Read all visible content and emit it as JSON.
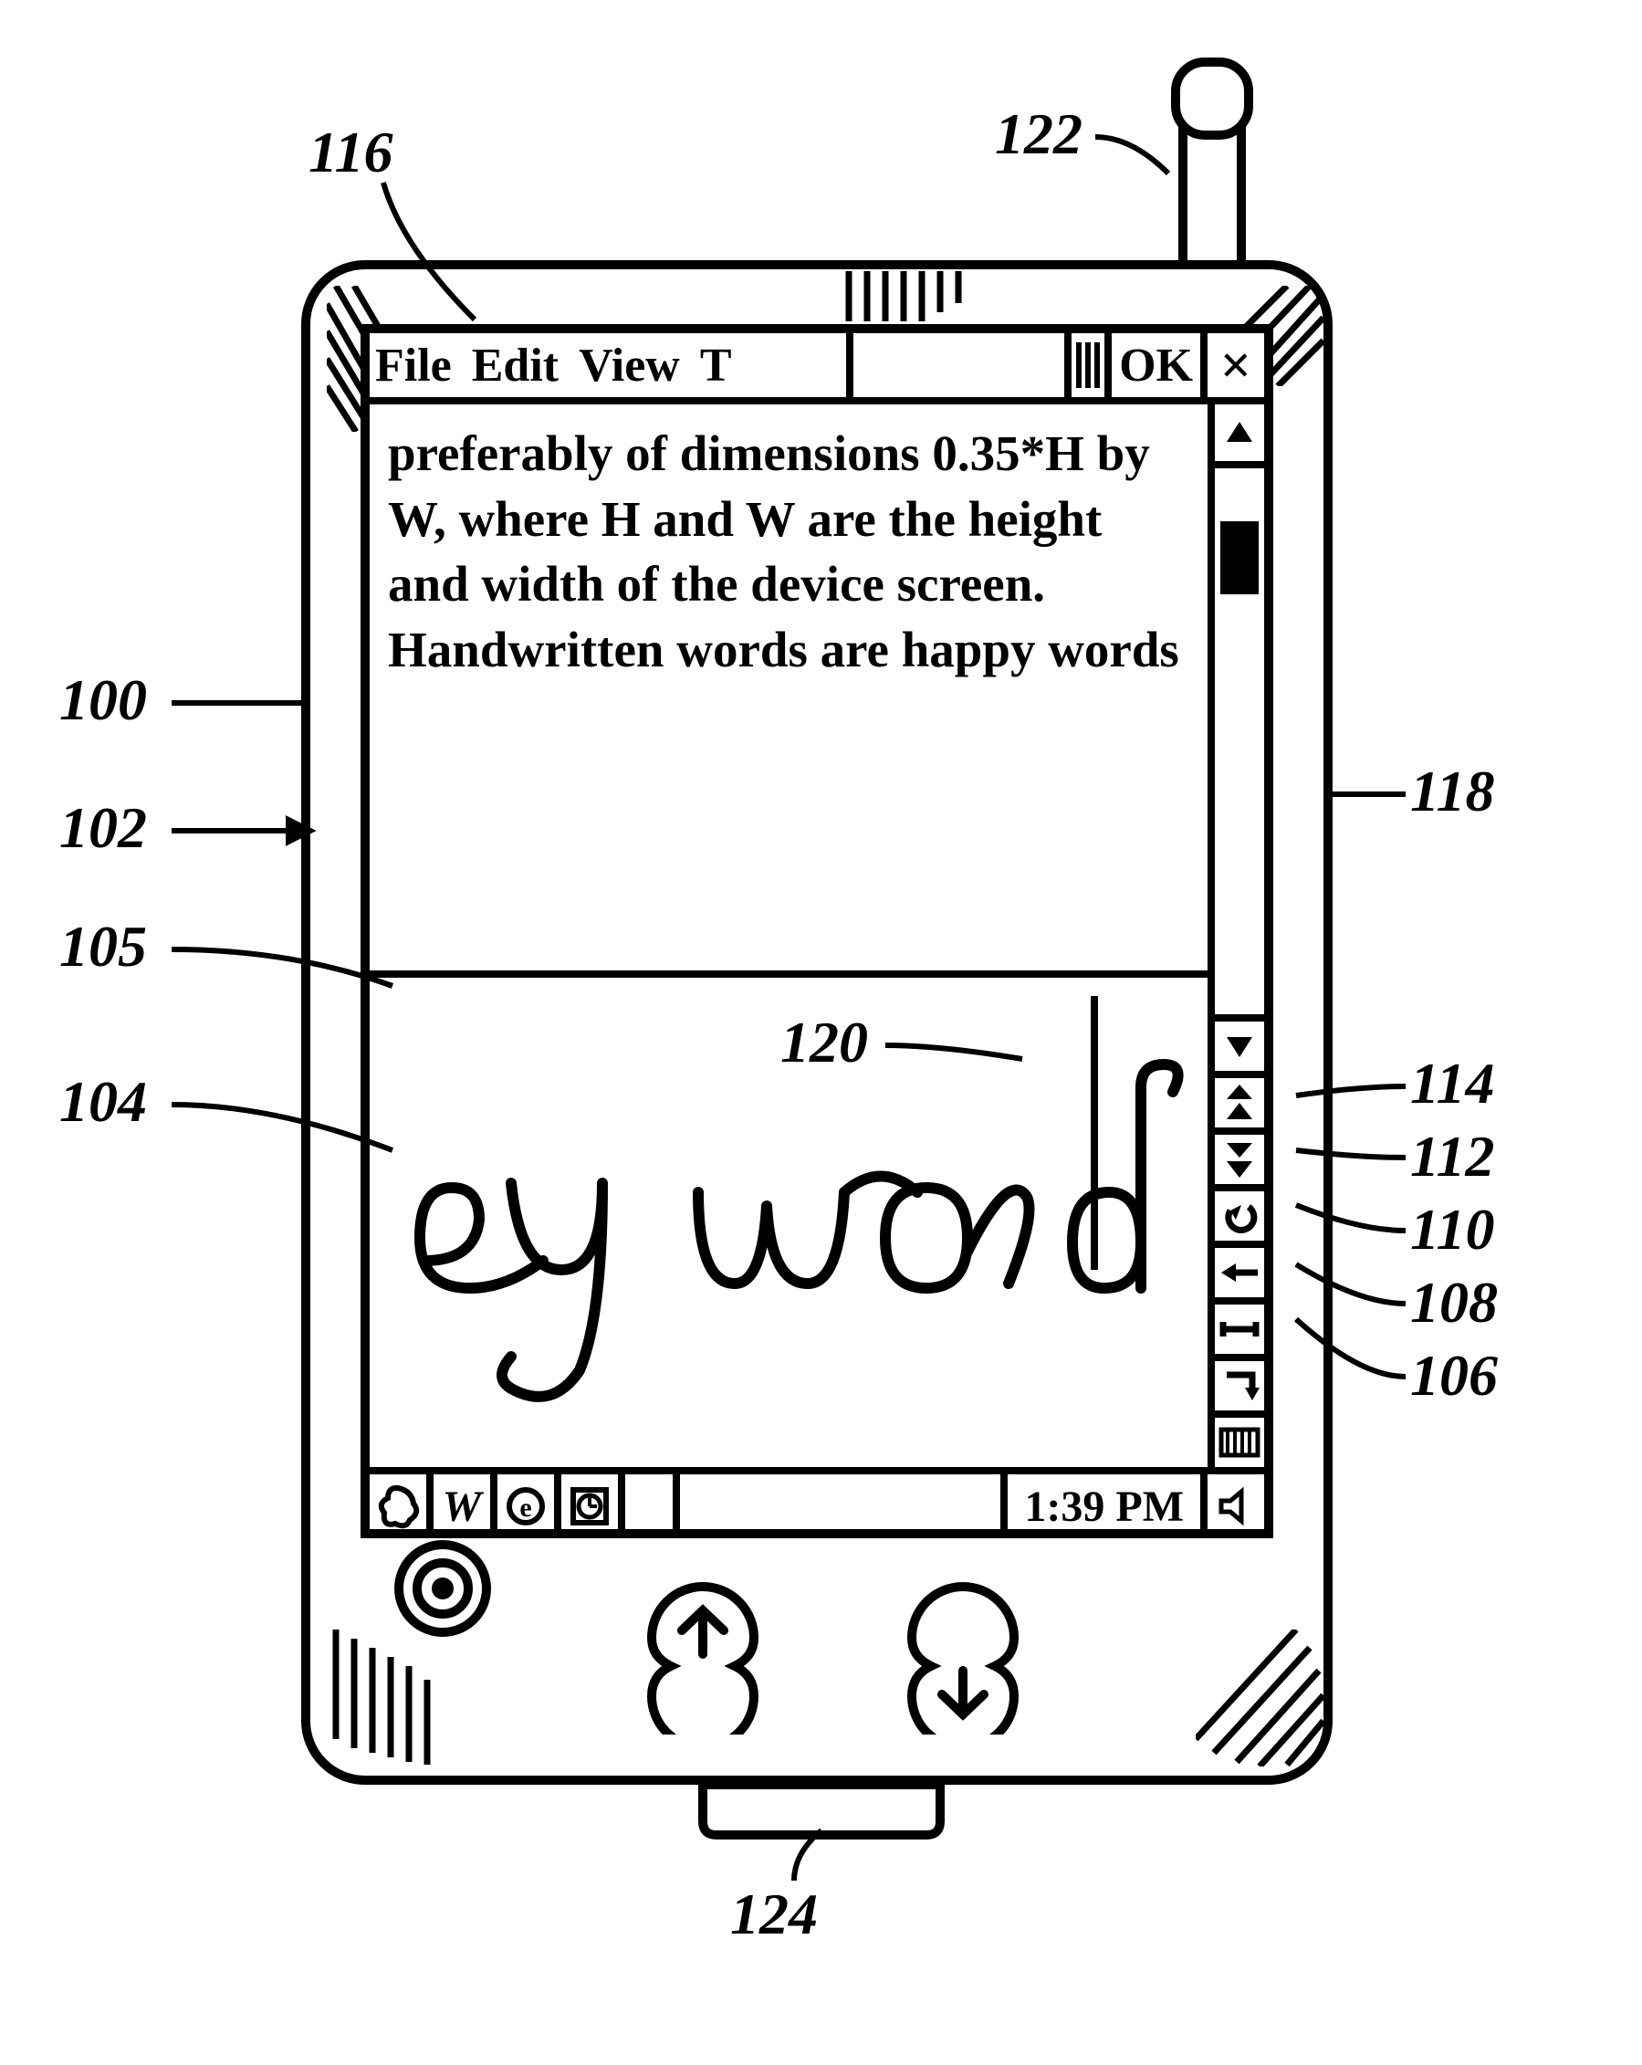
{
  "callouts": {
    "c116": "116",
    "c122": "122",
    "c100": "100",
    "c102": "102",
    "c105": "105",
    "c104": "104",
    "c118": "118",
    "c114": "114",
    "c112": "112",
    "c110": "110",
    "c108": "108",
    "c106": "106",
    "c120": "120",
    "c124": "124"
  },
  "menubar": {
    "file": "File",
    "edit": "Edit",
    "view": "View",
    "tools": "T",
    "ok": "OK",
    "close": "×"
  },
  "textpane": {
    "content": "preferably of dimensions 0.35*H by W, where H and W are the height and width of the device screen. Handwritten words are happy words"
  },
  "inkpane": {
    "handwriting": "ey words"
  },
  "rightcol": {
    "up": "▲",
    "down": "▼",
    "pageup_a": "▲",
    "pageup_b": "▲",
    "pagedown_a": "▼",
    "pagedown_b": "▼",
    "undo": "↶",
    "back": "←",
    "space": "␣",
    "enter": "↲",
    "keyboard": "kb"
  },
  "taskbar": {
    "start": "start",
    "w": "W",
    "e": "e",
    "clockicon": "clock",
    "time": "1:39 PM",
    "speaker": "spk"
  }
}
